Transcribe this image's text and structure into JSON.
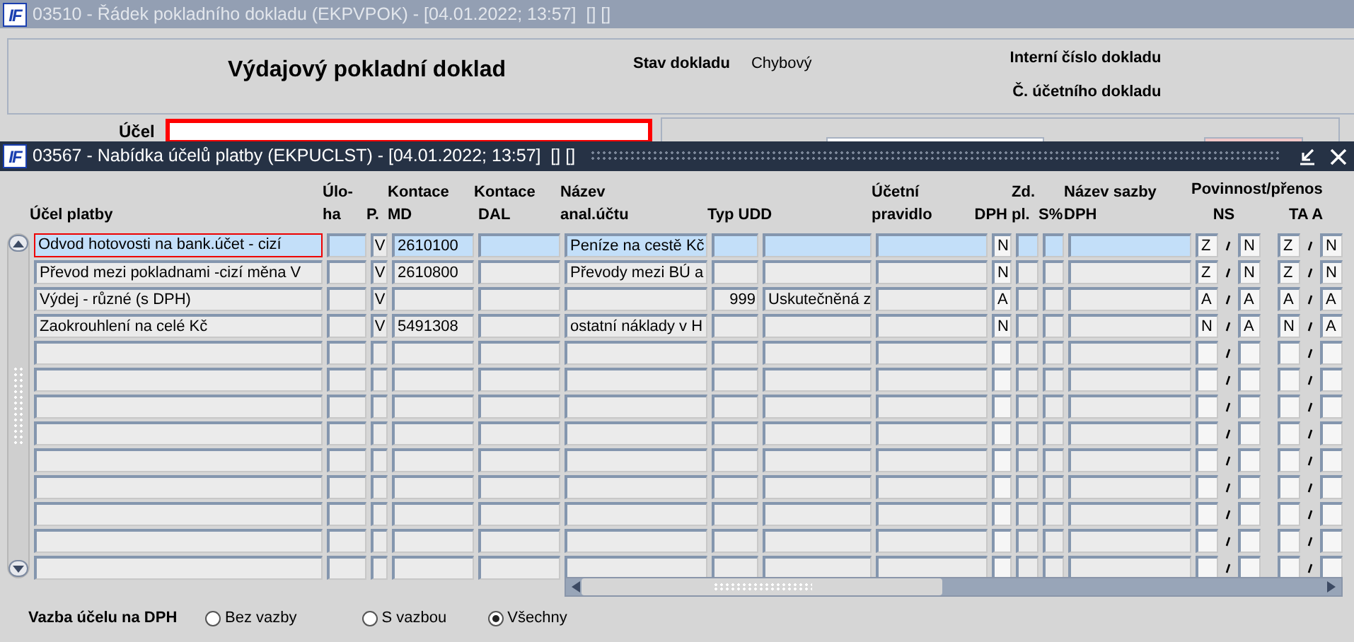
{
  "background_window": {
    "logo": "IF",
    "title": "03510 - Řádek pokladního dokladu (EKPVPOK) - [04.01.2022; 13:57]  [] []",
    "heading": "Výdajový pokladní doklad",
    "status_label": "Stav dokladu",
    "status_value": "Chybový",
    "internal_number_label": "Interní číslo dokladu",
    "accounting_number_label": "Č. účetního dokladu",
    "purpose_label": "Účel",
    "purpose_invalid": true
  },
  "dialog": {
    "logo": "IF",
    "title": "03567 - Nabídka účelů platby (EKPUCLST) - [04.01.2022; 13:57]  [] []",
    "columns": [
      {
        "kind": "text"
      },
      {
        "kind": "text"
      },
      {
        "kind": "code"
      },
      {
        "kind": "text"
      },
      {
        "kind": "text"
      },
      {
        "kind": "text"
      },
      {
        "kind": "number"
      },
      {
        "kind": "text"
      },
      {
        "kind": "text"
      },
      {
        "kind": "flag"
      },
      {
        "kind": "text"
      },
      {
        "kind": "text"
      },
      {
        "kind": "text"
      },
      {
        "kind": "flag"
      },
      {
        "kind": "paired_flag"
      },
      {
        "kind": "flag"
      },
      {
        "kind": "paired_flag"
      }
    ],
    "headers": [
      {
        "lines": [
          "Úlo-",
          "ha"
        ],
        "kind": "bottom"
      },
      {
        "lines": [
          "Kontace",
          "MD"
        ],
        "kind": "bottom"
      },
      {
        "lines": [
          "Kontace",
          " DAL"
        ],
        "kind": "bottom"
      },
      {
        "lines": [
          "Název",
          "anal.účtu"
        ],
        "kind": "bottom"
      },
      {
        "lines": [
          "Účetní",
          "pravidlo"
        ],
        "kind": "bottom"
      },
      {
        "lines": [
          "Zd.",
          "pl."
        ],
        "kind": "bottom"
      },
      {
        "lines": [
          "Název sazby",
          "DPH"
        ],
        "kind": "bottom"
      },
      {
        "lines": [
          "Povinnost/přenos"
        ],
        "kind": "group"
      },
      {
        "lines": [
          "Účel platby"
        ],
        "kind": "bottom"
      },
      {
        "lines": [
          "P."
        ],
        "kind": "bottom"
      },
      {
        "lines": [
          "Typ UDD"
        ],
        "kind": "bottom"
      },
      {
        "lines": [
          "DPH"
        ],
        "kind": "overhang"
      },
      {
        "lines": [
          "S%"
        ],
        "kind": "bottom"
      },
      {
        "lines": [
          "NS"
        ],
        "kind": "sub"
      },
      {
        "lines": [
          "TA A"
        ],
        "kind": "sub"
      }
    ],
    "rows": [
      {
        "selected": true,
        "focused": true,
        "cells": [
          "Odvod hotovosti na bank.účet - cizí",
          null,
          "V",
          "2610100",
          null,
          "Peníze na cestě Kč",
          null,
          null,
          null,
          "N",
          null,
          null,
          null,
          "Z",
          "N",
          "Z",
          "N"
        ]
      },
      {
        "selected": false,
        "focused": false,
        "cells": [
          "Převod mezi pokladnami -cizí měna V",
          null,
          "V",
          "2610800",
          null,
          "Převody mezi BÚ a",
          null,
          null,
          null,
          "N",
          null,
          null,
          null,
          "Z",
          "N",
          "Z",
          "N"
        ]
      },
      {
        "selected": false,
        "focused": false,
        "cells": [
          "Výdej - různé (s DPH)",
          null,
          "V",
          null,
          null,
          null,
          "999",
          "Uskutečněná z",
          null,
          "A",
          null,
          null,
          null,
          "A",
          "A",
          "A",
          "A"
        ]
      },
      {
        "selected": false,
        "focused": false,
        "cells": [
          "Zaokrouhlení na celé Kč",
          null,
          "V",
          "5491308",
          null,
          "ostatní náklady v H",
          null,
          null,
          null,
          "N",
          null,
          null,
          null,
          "N",
          "A",
          "N",
          "A"
        ]
      },
      {
        "selected": false,
        "focused": false
      },
      {
        "selected": false,
        "focused": false
      },
      {
        "selected": false,
        "focused": false
      },
      {
        "selected": false,
        "focused": false
      },
      {
        "selected": false,
        "focused": false
      },
      {
        "selected": false,
        "focused": false
      },
      {
        "selected": false,
        "focused": false
      },
      {
        "selected": false,
        "focused": false
      },
      {
        "selected": false,
        "focused": false
      }
    ],
    "filter": {
      "label": "Vazba účelu na DPH",
      "options": [
        {
          "label": "Bez vazby",
          "selected": false
        },
        {
          "label": "S vazbou",
          "selected": false
        },
        {
          "label": "Všechny",
          "selected": true
        }
      ]
    }
  }
}
